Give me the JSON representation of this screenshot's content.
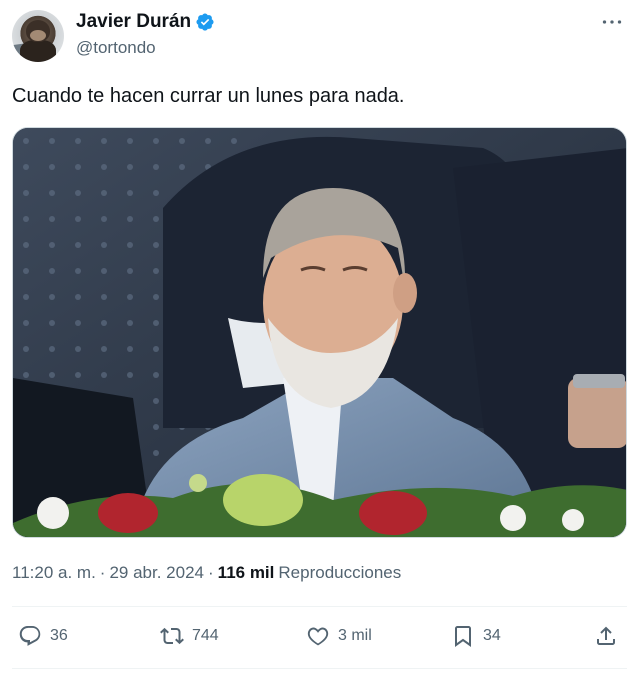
{
  "author": {
    "display_name": "Javier Durán",
    "handle": "@tortondo",
    "verified": true,
    "avatar_icon": "chimpanzee-avatar"
  },
  "tweet": {
    "text": "Cuando te hacen currar un lunes para nada.",
    "media_icon": "photo"
  },
  "meta": {
    "time": "11:20 a. m.",
    "separator": "·",
    "date": "29 abr. 2024",
    "views_count": "116 mil",
    "views_label": "Reproducciones"
  },
  "actions": {
    "replies": "36",
    "retweets": "744",
    "likes": "3 mil",
    "bookmarks": "34"
  },
  "colors": {
    "text": "#0f1419",
    "secondary": "#536471",
    "verified": "#1d9bf0",
    "divider": "#eff3f4"
  }
}
